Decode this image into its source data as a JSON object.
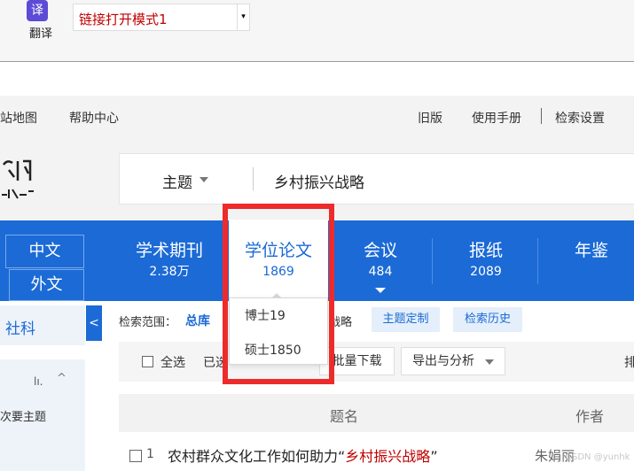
{
  "toolbar": {
    "translate_icon_glyph": "译",
    "translate_label": "翻译",
    "mode_value": "链接打开模式1"
  },
  "topbar": {
    "site_map": "站地图",
    "help": "帮助中心",
    "old_version": "旧版",
    "manual": "使用手册",
    "settings": "检索设置"
  },
  "search": {
    "field": "主题",
    "query": "乡村振兴战略"
  },
  "lang": {
    "zh": "中文",
    "en": "外文"
  },
  "nav": {
    "journals": {
      "name": "学术期刊",
      "count": "2.38万"
    },
    "thesis": {
      "name": "学位论文",
      "count": "1869"
    },
    "conference": {
      "name": "会议",
      "count": "484"
    },
    "newspaper": {
      "name": "报纸",
      "count": "2089"
    },
    "yearbook": {
      "name": "年鉴"
    }
  },
  "dropdown": {
    "phd": "博士19",
    "master": "硕士1850"
  },
  "left": {
    "social_science": "社科",
    "collapse": "<",
    "bar_icon": "lı.",
    "up_icon": "^",
    "secondary_topic": "次要主题"
  },
  "filters": {
    "scope_label": "检索范围：",
    "scope_value": "总库",
    "strategy_fragment": "战略",
    "topic_custom": "主题定制",
    "history": "检索历史"
  },
  "results": {
    "select_all": "全选",
    "selected": "已选",
    "batch_download": "批量下载",
    "export": "导出与分析",
    "sort": "排"
  },
  "table": {
    "col_title": "题名",
    "col_author": "作者",
    "rows": [
      {
        "index": "1",
        "title_prefix": "农村群众文化工作如何助力“",
        "title_highlight": "乡村振兴战略",
        "title_suffix": "”",
        "author": "朱娟丽"
      }
    ]
  },
  "watermark": "CSDN @yunhk",
  "colors": {
    "primary_blue": "#1b6ad6",
    "highlight_red": "#c00000",
    "annotation_red": "#ee2b2b"
  }
}
